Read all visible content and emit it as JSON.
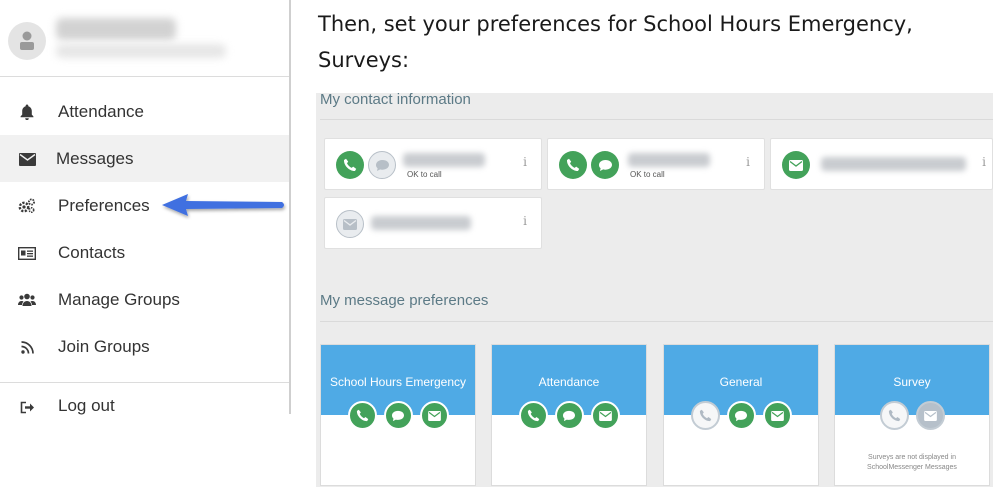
{
  "instruction": {
    "line1": "Then, set your preferences for School Hours Emergency,",
    "line2": "Surveys:"
  },
  "sidebar": {
    "items": [
      {
        "label": "Attendance",
        "icon": "bell-icon"
      },
      {
        "label": "Messages",
        "icon": "envelope-icon"
      },
      {
        "label": "Preferences",
        "icon": "gears-icon"
      },
      {
        "label": "Contacts",
        "icon": "address-card-icon"
      },
      {
        "label": "Manage Groups",
        "icon": "users-icon"
      },
      {
        "label": "Join Groups",
        "icon": "rss-icon"
      }
    ],
    "logout_label": "Log out",
    "active_item": "Messages"
  },
  "contact_section": {
    "title": "My contact information",
    "cards": [
      {
        "status": "OK to call",
        "info": "i"
      },
      {
        "status": "OK to call",
        "info": "i"
      },
      {
        "info": "i"
      },
      {
        "info": "i"
      }
    ]
  },
  "preferences_section": {
    "title": "My message preferences",
    "cards": [
      {
        "title": "School Hours Emergency"
      },
      {
        "title": "Attendance"
      },
      {
        "title": "General"
      },
      {
        "title": "Survey",
        "note_line1": "Surveys are not displayed in",
        "note_line2": "SchoolMessenger Messages"
      }
    ]
  },
  "colors": {
    "accent_blue": "#4faae5",
    "green": "#43a25a",
    "arrow_blue": "#3f6fe0",
    "panel_bg": "#ececec"
  }
}
